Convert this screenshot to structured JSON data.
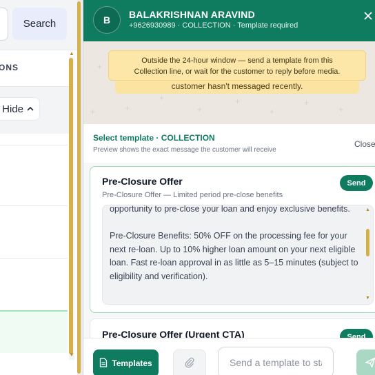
{
  "left_app": {
    "search_label": "Search",
    "section_label": "ONS",
    "hide_label": "Hide"
  },
  "header": {
    "avatar_initial": "B",
    "contact_name": "BALAKRISHNAN ARAVIND",
    "contact_sub": "+9626930989 · COLLECTION · Template required"
  },
  "notice": {
    "front_line1": "Outside the 24-hour window — send a template from this",
    "front_line2": "Collection line, or wait for the customer to reply before media.",
    "back_text": "customer hasn't messaged recently."
  },
  "template_picker": {
    "title": "Select template · COLLECTION",
    "subtitle": "Preview shows the exact message the customer will receive",
    "close_label": "Close"
  },
  "templates": [
    {
      "name": "Pre-Closure Offer",
      "description": "Pre-Closure Offer — Limited period pre-close benefits",
      "send_label": "Send",
      "preview_p1": "opportunity to pre-close your loan and enjoy exclusive benefits.",
      "preview_p2": "Pre-Closure Benefits: 50% OFF on the processing fee for your next re-loan. Up to 10% higher loan amount on your next eligible loan. Fast re-loan approval in as little as 5–15 minutes (subject to eligibility and verification)."
    },
    {
      "name": "Pre-Closure Offer (Urgent CTA)",
      "send_label": "Send"
    }
  ],
  "composer": {
    "templates_button": "Templates",
    "placeholder": "Send a template to start"
  },
  "colors": {
    "brand_green": "#0f7b5f",
    "notice_yellow": "#fde7a8",
    "scroll_gold": "#d4b04a"
  }
}
